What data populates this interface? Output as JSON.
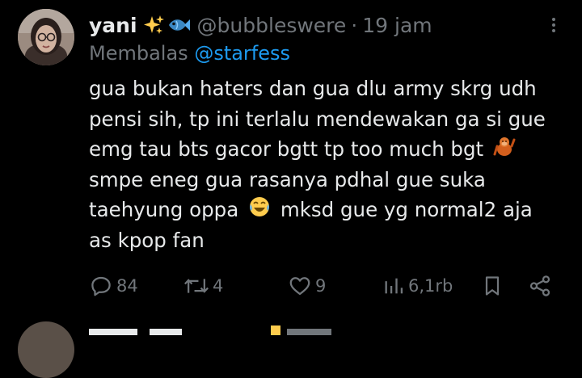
{
  "colors": {
    "background": "#000000",
    "text_primary": "#e7e9ea",
    "text_secondary": "#71767b",
    "mention": "#1d9bf0"
  },
  "tweet": {
    "author": {
      "display_name": "yani",
      "emojis": [
        "sparkles-emoji",
        "fish-emoji"
      ],
      "handle": "@bubbleswere",
      "separator": "·",
      "time": "19 jam"
    },
    "reply_to": {
      "prefix": "Membalas",
      "mention": "@starfess"
    },
    "text_lines": [
      "gua bukan haters dan gua dlu army skrg udh",
      "pensi sih, tp ini terlalu mendewakan ga si gue",
      "emg tau bts gacor bgtt tp too much bgt",
      "smpe eneg gua rasanya pdhal gue suka",
      "taehyung oppa",
      "mksd gue yg normal2 aja",
      "as kpop fan"
    ],
    "inline_emojis": [
      "orangutan-emoji",
      "face-with-tears-of-joy-emoji"
    ],
    "actions": {
      "replies": "84",
      "retweets": "4",
      "likes": "9",
      "views": "6,1rb"
    },
    "icons": [
      "more-icon",
      "reply-icon",
      "retweet-icon",
      "like-icon",
      "views-icon",
      "bookmark-icon",
      "share-icon"
    ]
  }
}
